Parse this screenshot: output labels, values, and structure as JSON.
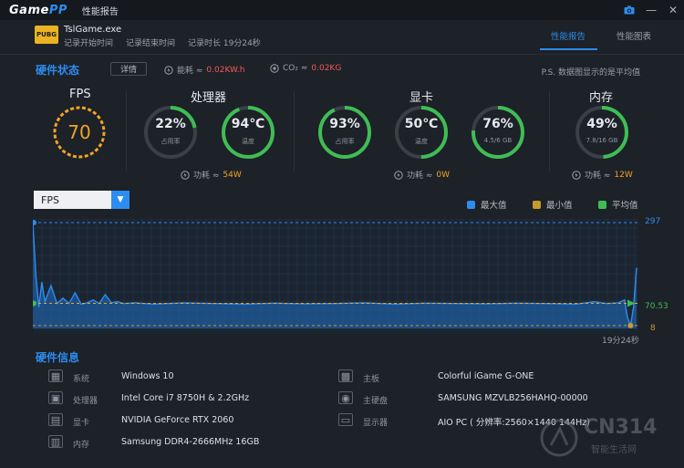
{
  "app": {
    "logo_a": "Game",
    "logo_b": "PP",
    "title": "性能报告"
  },
  "titlebar": {
    "camera_icon": "camera-icon",
    "minimize_icon": "minimize-icon",
    "close_icon": "close-icon"
  },
  "game": {
    "badge": "PUBG",
    "name": "TslGame.exe",
    "record_start": "记录开始时间",
    "record_end": "记录结束时间",
    "record_len": "记录时长 19分24秒"
  },
  "tabs": [
    {
      "label": "性能报告",
      "active": true
    },
    {
      "label": "性能图表",
      "active": false
    }
  ],
  "hw_status": {
    "title": "硬件状态",
    "detail_btn": "详情",
    "energy_label": "能耗 ≈",
    "energy_value": "0.02KW.h",
    "co2_label": "CO₂ ≈",
    "co2_value": "0.02KG",
    "note": "P.S. 数据图显示的是平均值"
  },
  "fps": {
    "title": "FPS",
    "value": "70",
    "fraction": 0.7
  },
  "cpu": {
    "title": "处理器",
    "usage": "22%",
    "usage_label": "占用率",
    "usage_fraction": 0.22,
    "temp": "94℃",
    "temp_label": "温度",
    "temp_fraction": 0.94,
    "power_label": "功耗 ≈",
    "power": "54W"
  },
  "gpu": {
    "title": "显卡",
    "usage": "93%",
    "usage_label": "占用率",
    "usage_fraction": 0.93,
    "temp": "50℃",
    "temp_label": "温度",
    "temp_fraction": 0.5,
    "vram": "76%",
    "vram_label": "4.5/6 GB",
    "vram_fraction": 0.76,
    "power_label": "功耗 ≈",
    "power": "0W"
  },
  "mem": {
    "title": "内存",
    "usage": "49%",
    "usage_label": "7.8/16 GB",
    "usage_fraction": 0.49,
    "power_label": "功耗 ≈",
    "power": "12W"
  },
  "colors": {
    "accent": "#2d8cf0",
    "good": "#3fbd54",
    "warn": "#f3a423",
    "gauge_bg": "#3a3f48"
  },
  "chart_select": {
    "value": "FPS"
  },
  "legend": [
    {
      "label": "最大值",
      "color": "#2d8cf0"
    },
    {
      "label": "最小值",
      "color": "#c8992b"
    },
    {
      "label": "平均值",
      "color": "#3fbd54"
    }
  ],
  "chart_data": {
    "type": "area",
    "metric": "FPS",
    "y_max_label": "297",
    "y_avg_label": "70.53",
    "y_min_label": "8",
    "x_end_label": "19分24秒",
    "max": 297,
    "avg": 70.53,
    "min": 8,
    "ylim": [
      0,
      297
    ],
    "x": [
      0,
      0.005,
      0.01,
      0.015,
      0.02,
      0.03,
      0.04,
      0.05,
      0.06,
      0.07,
      0.08,
      0.09,
      0.1,
      0.11,
      0.12,
      0.13,
      0.14,
      0.15,
      0.17,
      0.2,
      0.25,
      0.3,
      0.35,
      0.4,
      0.45,
      0.5,
      0.55,
      0.6,
      0.65,
      0.7,
      0.75,
      0.8,
      0.85,
      0.9,
      0.93,
      0.95,
      0.97,
      0.98,
      0.985,
      0.99,
      0.995,
      1.0
    ],
    "values": [
      297,
      150,
      60,
      130,
      75,
      120,
      70,
      85,
      70,
      100,
      68,
      72,
      80,
      70,
      95,
      72,
      75,
      70,
      72,
      68,
      72,
      70,
      68,
      71,
      69,
      70,
      72,
      68,
      71,
      70,
      69,
      71,
      70,
      68,
      75,
      70,
      72,
      80,
      30,
      8,
      60,
      170
    ]
  },
  "hw_info": {
    "title": "硬件信息",
    "items": [
      {
        "icon": "windows-icon",
        "label": "系统",
        "value": "Windows 10"
      },
      {
        "icon": "cpu-icon",
        "label": "处理器",
        "value": "Intel Core i7 8750H & 2.2GHz"
      },
      {
        "icon": "gpu-icon",
        "label": "显卡",
        "value": "NVIDIA GeForce RTX 2060"
      },
      {
        "icon": "ram-icon",
        "label": "内存",
        "value": "Samsung DDR4-2666MHz 16GB"
      },
      {
        "icon": "motherboard-icon",
        "label": "主板",
        "value": "Colorful iGame G-ONE"
      },
      {
        "icon": "disk-icon",
        "label": "主硬盘",
        "value": "SAMSUNG MZVLB256HAHQ-00000"
      },
      {
        "icon": "monitor-icon",
        "label": "显示器",
        "value": "AIO PC ( 分辨率:2560×1440 144Hz)"
      }
    ]
  },
  "watermark": {
    "main": "CN314",
    "sub": "智能生活网"
  }
}
